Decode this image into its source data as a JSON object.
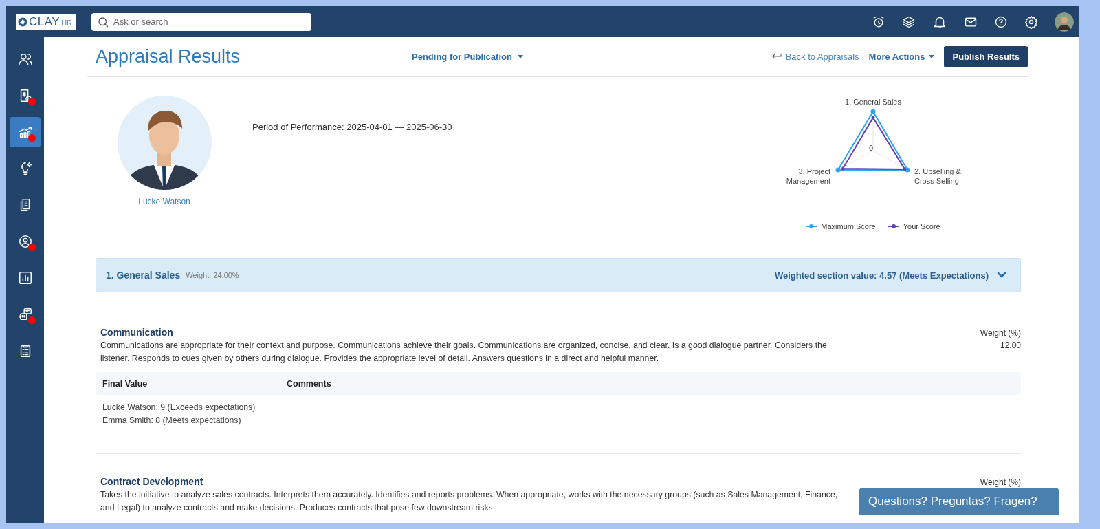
{
  "logo": {
    "text": "CLAY",
    "suffix": "HR"
  },
  "search": {
    "placeholder": "Ask or search"
  },
  "sidebar": {
    "items": [
      {
        "selected": false,
        "badge": false
      },
      {
        "selected": false,
        "badge": true
      },
      {
        "selected": true,
        "badge": true
      },
      {
        "selected": false,
        "badge": false
      },
      {
        "selected": false,
        "badge": false
      },
      {
        "selected": false,
        "badge": true
      },
      {
        "selected": false,
        "badge": false
      },
      {
        "selected": false,
        "badge": true
      },
      {
        "selected": false,
        "badge": false
      }
    ]
  },
  "header": {
    "title": "Appraisal Results",
    "status": "Pending for Publication",
    "back_link": "Back to Appraisals",
    "more_actions": "More Actions",
    "primary_button": "Publish Results"
  },
  "employee": {
    "name": "Lucke Watson",
    "period": "Period of Performance: 2025-04-01 — 2025-06-30"
  },
  "radar": {
    "axis_labels": [
      "1. General Sales",
      "3. Project Management",
      "2. Upselling & Cross Selling"
    ],
    "center_label": "0",
    "legend": [
      {
        "name": "Maximum Score",
        "color": "#29a8f0"
      },
      {
        "name": "Your Score",
        "color": "#5b3fc4"
      }
    ]
  },
  "section": {
    "title": "1. General Sales",
    "weight": "Weight: 24.00%",
    "summary": "Weighted section value: 4.57 (Meets Expectations)",
    "expanded": true
  },
  "criteria": [
    {
      "title": "Communication",
      "description": "Communications are appropriate for their context and purpose. Communications achieve their goals. Communications are organized, concise, and clear. Is a good dialogue partner. Considers the listener. Responds to cues given by others during dialogue. Provides the appropriate level of detail. Answers questions in a direct and helpful manner.",
      "weight_label": "Weight (%)",
      "weight": "12.00",
      "table": {
        "columns": [
          "Final Value",
          "Comments"
        ],
        "values": [
          "Lucke Watson: 9 (Exceeds expectations)",
          "Emma Smith: 8 (Meets expectations)"
        ]
      }
    },
    {
      "title": "Contract Development",
      "description": "Takes the initiative to analyze sales contracts. Interprets them accurately. Identifies and reports problems. When appropriate, works with the necessary groups (such as Sales Management, Finance, and Legal) to analyze contracts and make decisions. Produces contracts that pose few downstream risks.",
      "weight_label": "Weight (%)"
    }
  ],
  "chat_button": "Questions? Preguntas? Fragen?"
}
